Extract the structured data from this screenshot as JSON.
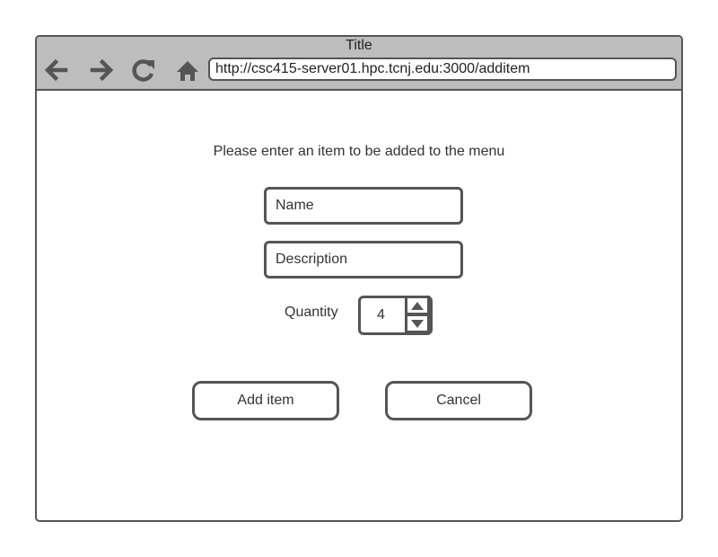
{
  "window": {
    "title": "Title",
    "url": "http://csc415-server01.hpc.tcnj.edu:3000/additem"
  },
  "nav": {
    "back_icon": "arrow-left-icon",
    "forward_icon": "arrow-right-icon",
    "reload_icon": "reload-icon",
    "home_icon": "home-icon"
  },
  "form": {
    "prompt": "Please enter an item to be added to the menu",
    "name_placeholder": "Name",
    "description_placeholder": "Description",
    "quantity_label": "Quantity",
    "quantity_value": "4",
    "add_label": "Add item",
    "cancel_label": "Cancel"
  },
  "colors": {
    "chrome": "#bdbdbd",
    "border": "#555555"
  }
}
